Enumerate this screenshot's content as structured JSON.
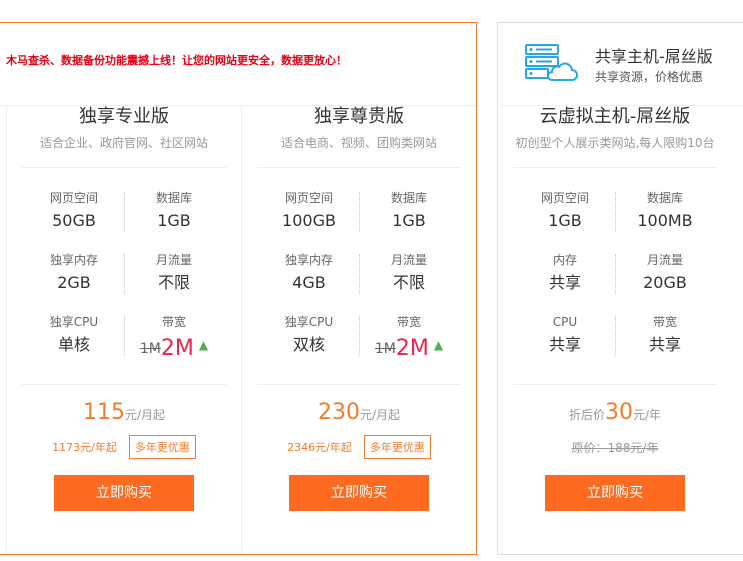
{
  "notice": "木马查杀、数据备份功能震撼上线！让您的网站更安全，数据更放心！",
  "shared": {
    "title": "共享主机-屌丝版",
    "subtitle": "共享资源，价格优惠",
    "icon": "server-cloud-icon"
  },
  "colors": {
    "accent": "#f37b2c",
    "button": "#ff6a21",
    "highlight": "#e8264d",
    "notice": "#e60012",
    "arrow": "#4caf50"
  },
  "plans": [
    {
      "name": "独享专业版",
      "desc": "适合企业、政府官网、社区网站",
      "specs": [
        {
          "label": "网页空间",
          "value": "50GB"
        },
        {
          "label": "数据库",
          "value": "1GB"
        },
        {
          "label": "独享内存",
          "value": "2GB"
        },
        {
          "label": "月流量",
          "value": "不限"
        },
        {
          "label": "独享CPU",
          "value": "单核"
        },
        {
          "label": "带宽",
          "old": "1M",
          "new": "2M",
          "arrow": "▲"
        }
      ],
      "price": "115",
      "price_unit": "元/月起",
      "year_price": "1173元/年起",
      "badge": "多年更优惠",
      "buy": "立即购买"
    },
    {
      "name": "独享尊贵版",
      "desc": "适合电商、视频、团购类网站",
      "specs": [
        {
          "label": "网页空间",
          "value": "100GB"
        },
        {
          "label": "数据库",
          "value": "1GB"
        },
        {
          "label": "独享内存",
          "value": "4GB"
        },
        {
          "label": "月流量",
          "value": "不限"
        },
        {
          "label": "独享CPU",
          "value": "双核"
        },
        {
          "label": "带宽",
          "old": "1M",
          "new": "2M",
          "arrow": "▲"
        }
      ],
      "price": "230",
      "price_unit": "元/月起",
      "year_price": "2346元/年起",
      "badge": "多年更优惠",
      "buy": "立即购买"
    },
    {
      "name": "云虚拟主机-屌丝版",
      "desc": "初创型个人展示类网站,每人限购10台",
      "specs": [
        {
          "label": "网页空间",
          "value": "1GB"
        },
        {
          "label": "数据库",
          "value": "100MB"
        },
        {
          "label": "内存",
          "value": "共享"
        },
        {
          "label": "月流量",
          "value": "20GB"
        },
        {
          "label": "CPU",
          "value": "共享"
        },
        {
          "label": "带宽",
          "value": "共享"
        }
      ],
      "price_prefix": "折后价",
      "price": "30",
      "price_unit": "元/年",
      "orig_price": "原价：188元/年",
      "buy": "立即购买"
    }
  ]
}
